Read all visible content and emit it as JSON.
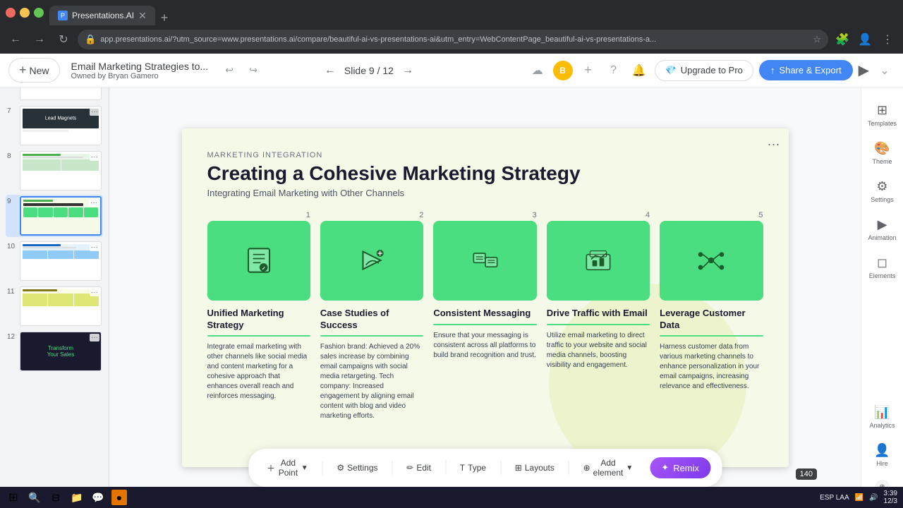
{
  "browser": {
    "tab_label": "Presentations.AI",
    "url": "app.presentations.ai/?utm_source=www.presentations.ai/compare/beautiful-ai-vs-presentations-ai&utm_entry=WebContentPage_beautiful-ai-vs-presentations-a...",
    "new_tab_label": "+"
  },
  "topbar": {
    "new_button": "New",
    "file_title": "Email Marketing Strategies to...",
    "file_owner": "Owned by Bryan Gamero",
    "slide_counter": "Slide 9 / 12",
    "upgrade_label": "Upgrade to Pro",
    "share_label": "Share & Export"
  },
  "slide": {
    "marketing_label": "MARKETING INTEGRATION",
    "title": "Creating a Cohesive Marketing Strategy",
    "subtitle": "Integrating Email Marketing with Other Channels",
    "cards": [
      {
        "num": "1",
        "title": "Unified Marketing Strategy",
        "text": "Integrate email marketing with other channels like social media and content marketing for a cohesive approach that enhances overall reach and reinforces messaging."
      },
      {
        "num": "2",
        "title": "Case Studies of Success",
        "text": "Fashion brand: Achieved a 20% sales increase by combining email campaigns with social media retargeting. Tech company: Increased engagement by aligning email content with blog and video marketing efforts."
      },
      {
        "num": "3",
        "title": "Consistent Messaging",
        "text": "Ensure that your messaging is consistent across all platforms to build brand recognition and trust."
      },
      {
        "num": "4",
        "title": "Drive Traffic with Email",
        "text": "Utilize email marketing to direct traffic to your website and social media channels, boosting visibility and engagement."
      },
      {
        "num": "5",
        "title": "Leverage Customer Data",
        "text": "Harness customer data from various marketing channels to enhance personalization in your email campaigns, increasing relevance and effectiveness."
      }
    ]
  },
  "right_sidebar": [
    {
      "label": "Templates",
      "icon": "⊞"
    },
    {
      "label": "Theme",
      "icon": "🎨"
    },
    {
      "label": "Settings",
      "icon": "⚙"
    },
    {
      "label": "Animation",
      "icon": "▶"
    },
    {
      "label": "Elements",
      "icon": "◻"
    },
    {
      "label": "Analytics",
      "icon": "📊"
    },
    {
      "label": "Hire",
      "icon": "👤"
    }
  ],
  "bottom_toolbar": {
    "add_point": "Add Point",
    "settings": "Settings",
    "edit": "Edit",
    "type": "Type",
    "layouts": "Layouts",
    "add_element": "Add element",
    "remix": "Remix"
  },
  "slide_count": "140",
  "taskbar": {
    "time": "3:39",
    "date": "12/3",
    "lang": "ESP LAA"
  }
}
